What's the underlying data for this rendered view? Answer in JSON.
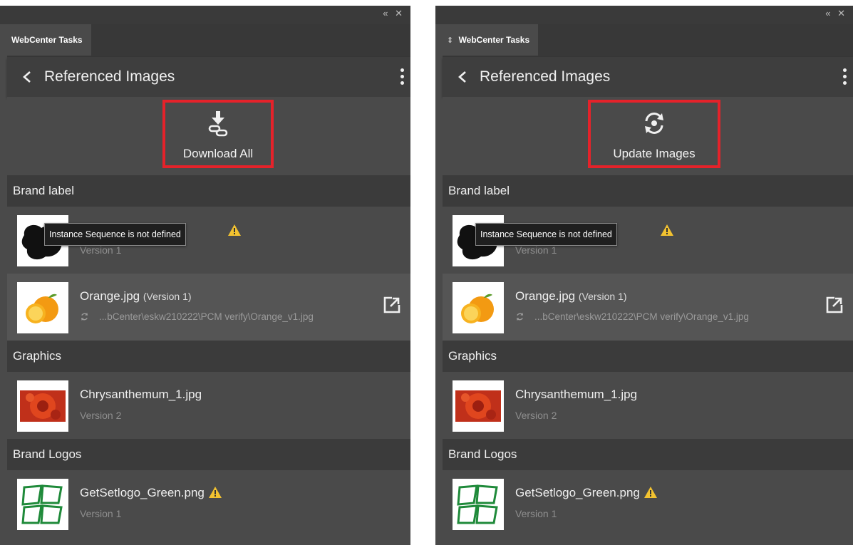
{
  "panels": [
    {
      "tab_label": "WebCenter Tasks",
      "header_title": "Referenced Images",
      "action_label": "Download All"
    },
    {
      "tab_label": "WebCenter Tasks",
      "header_title": "Referenced Images",
      "action_label": "Update Images"
    }
  ],
  "groups": {
    "brand_label": "Brand label",
    "graphics": "Graphics",
    "brand_logos": "Brand Logos"
  },
  "items": {
    "brand_item_1": {
      "tooltip": "Instance Sequence is not defined",
      "version": "Version 1",
      "icons": [
        "warning-icon"
      ]
    },
    "orange": {
      "title": "Orange.jpg",
      "version_note": "(Version 1)",
      "path": "...bCenter\\eskw210222\\PCM verify\\Orange_v1.jpg",
      "icons": [
        "sync-icon",
        "open-external-icon"
      ]
    },
    "chrysanthemum": {
      "title": "Chrysanthemum_1.jpg",
      "version": "Version 2"
    },
    "getset": {
      "title": "GetSetlogo_Green.png",
      "version": "Version 1",
      "icons": [
        "warning-icon"
      ]
    }
  },
  "colors": {
    "highlight_box": "#e5222a",
    "warning": "#f2c230",
    "panel_bg": "#4a4a4a",
    "group_bg": "#3b3b3b"
  }
}
